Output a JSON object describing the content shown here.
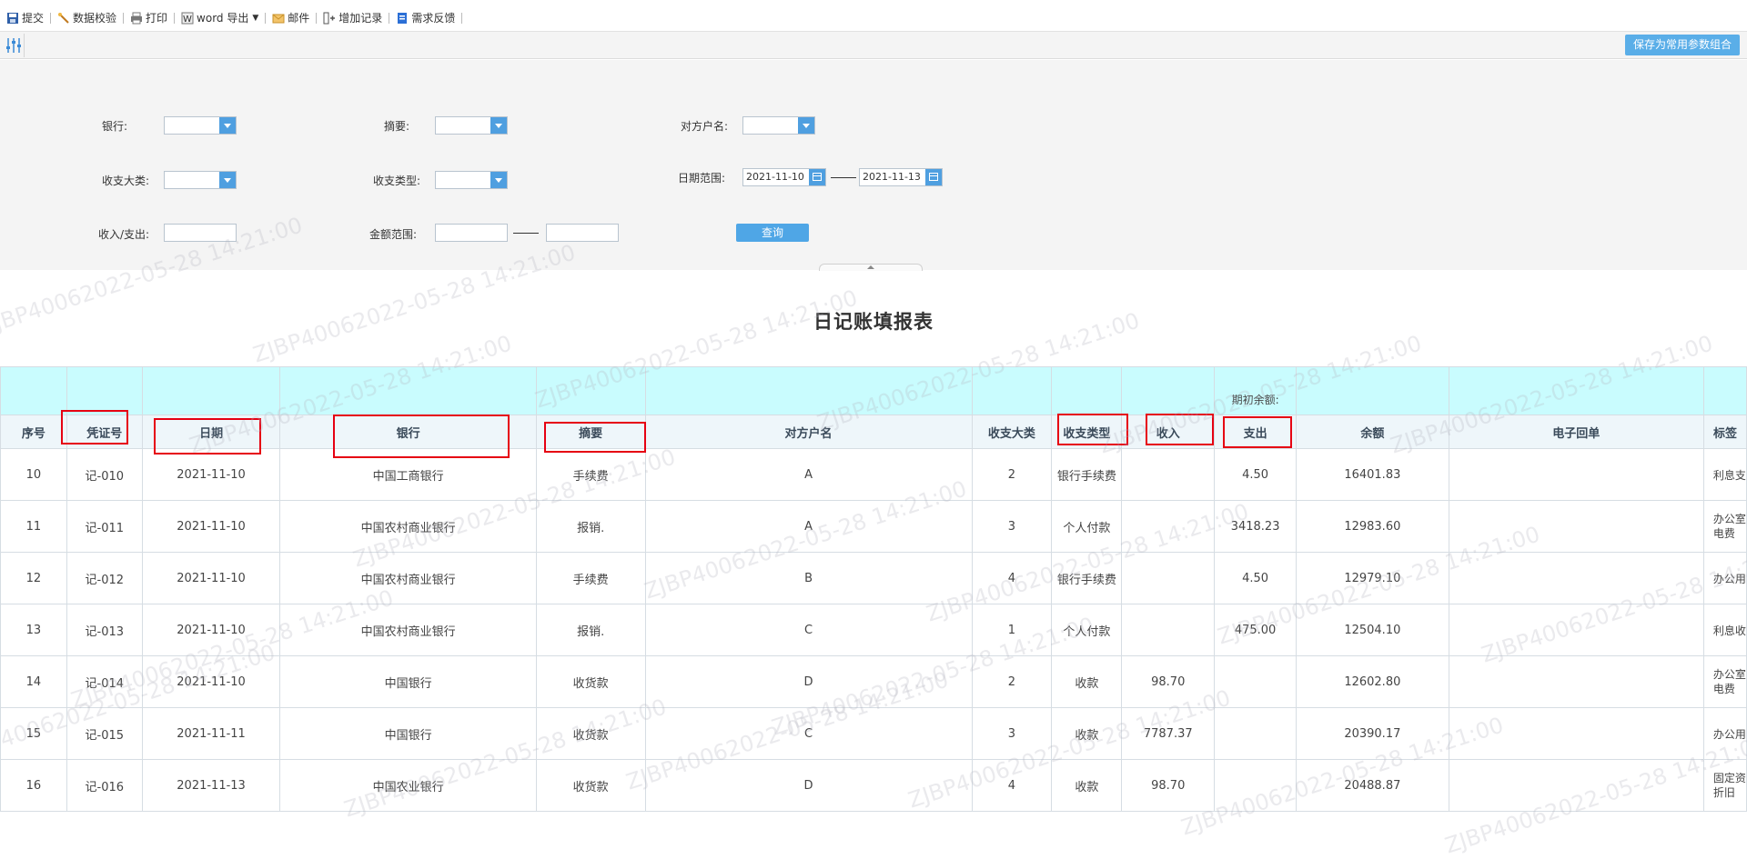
{
  "toolbar": {
    "items": [
      {
        "label": "提交",
        "icon": "save-icon"
      },
      {
        "label": "数据校验",
        "icon": "magic-wand-icon"
      },
      {
        "label": "打印",
        "icon": "printer-icon"
      },
      {
        "label": "word 导出",
        "icon": "word-icon"
      },
      {
        "label": "邮件",
        "icon": "mail-icon"
      },
      {
        "label": "增加记录",
        "icon": "add-record-icon"
      },
      {
        "label": "需求反馈",
        "icon": "clipboard-icon"
      }
    ],
    "save_params_label": "保存为常用参数组合"
  },
  "query": {
    "bank_label": "银行:",
    "summary_label": "摘要:",
    "counterparty_label": "对方户名:",
    "category_label": "收支大类:",
    "type_label": "收支类型:",
    "date_range_label": "日期范围:",
    "date_from": "2021-11-10",
    "date_to": "2021-11-13",
    "inout_label": "收入/支出:",
    "amount_range_label": "金额范围:",
    "query_button": "查询"
  },
  "report": {
    "title": "日记账填报表",
    "opening_balance_label": "期初余额:",
    "columns": [
      "序号",
      "凭证号",
      "日期",
      "银行",
      "摘要",
      "对方户名",
      "收支大类",
      "收支类型",
      "收入",
      "支出",
      "余额",
      "电子回单",
      "标签"
    ],
    "rows": [
      [
        "10",
        "记-010",
        "2021-11-10",
        "中国工商银行",
        "手续费",
        "A",
        "2",
        "银行手续费",
        "",
        "4.50",
        "16401.83",
        "",
        "利息支"
      ],
      [
        "11",
        "记-011",
        "2021-11-10",
        "中国农村商业银行",
        "报销.",
        "A",
        "3",
        "个人付款",
        "",
        "3418.23",
        "12983.60",
        "",
        "办公室\n电费"
      ],
      [
        "12",
        "记-012",
        "2021-11-10",
        "中国农村商业银行",
        "手续费",
        "B",
        "4",
        "银行手续费",
        "",
        "4.50",
        "12979.10",
        "",
        "办公用"
      ],
      [
        "13",
        "记-013",
        "2021-11-10",
        "中国农村商业银行",
        "报销.",
        "C",
        "1",
        "个人付款",
        "",
        "475.00",
        "12504.10",
        "",
        "利息收"
      ],
      [
        "14",
        "记-014",
        "2021-11-10",
        "中国银行",
        "收货款",
        "D",
        "2",
        "收款",
        "98.70",
        "",
        "12602.80",
        "",
        "办公室\n电费"
      ],
      [
        "15",
        "记-015",
        "2021-11-11",
        "中国银行",
        "收货款",
        "C",
        "3",
        "收款",
        "7787.37",
        "",
        "20390.17",
        "",
        "办公用"
      ],
      [
        "16",
        "记-016",
        "2021-11-13",
        "中国农业银行",
        "收货款",
        "D",
        "4",
        "收款",
        "98.70",
        "",
        "20488.87",
        "",
        "固定资\n折旧"
      ]
    ]
  },
  "watermark": {
    "text": "ZJBP40062022-05-28 14:21:00"
  },
  "colors": {
    "accent": "#4fa6e6",
    "header_band": "#c9fcfe",
    "annotation_red": "#e60012"
  }
}
